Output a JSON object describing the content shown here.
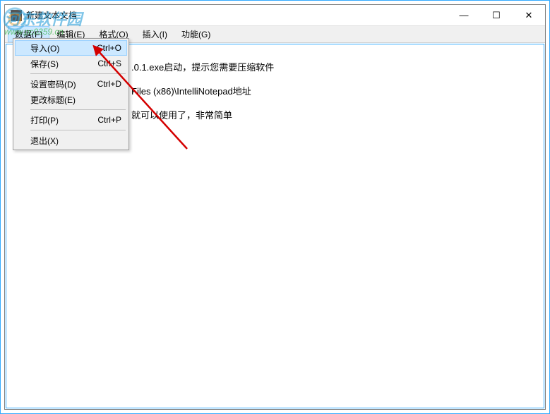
{
  "window": {
    "title": "新建文本文档"
  },
  "titlebar": {
    "minimize": "—",
    "maximize": "☐",
    "close": "✕"
  },
  "menubar": {
    "items": [
      {
        "label": "数据(F)",
        "active": true
      },
      {
        "label": "编辑(E)"
      },
      {
        "label": "格式(O)"
      },
      {
        "label": "插入(I)"
      },
      {
        "label": "功能(G)"
      }
    ]
  },
  "dropdown": {
    "items": [
      {
        "label": "导入(O)",
        "shortcut": "Ctrl+O",
        "hover": true
      },
      {
        "label": "保存(S)",
        "shortcut": "Ctrl+S"
      },
      {
        "type": "separator"
      },
      {
        "label": "设置密码(D)",
        "shortcut": "Ctrl+D"
      },
      {
        "label": "更改标题(E)",
        "shortcut": ""
      },
      {
        "type": "separator"
      },
      {
        "label": "打印(P)",
        "shortcut": "Ctrl+P"
      },
      {
        "type": "separator"
      },
      {
        "label": "退出(X)",
        "shortcut": ""
      }
    ]
  },
  "editor": {
    "lines": [
      ".0.1.exe启动，提示您需要压缩软件",
      "Files (x86)\\IntelliNotepad地址",
      "就可以使用了，非常简单"
    ]
  },
  "watermark": {
    "text": "河东软件园",
    "url": "www.pc0359.cn"
  }
}
